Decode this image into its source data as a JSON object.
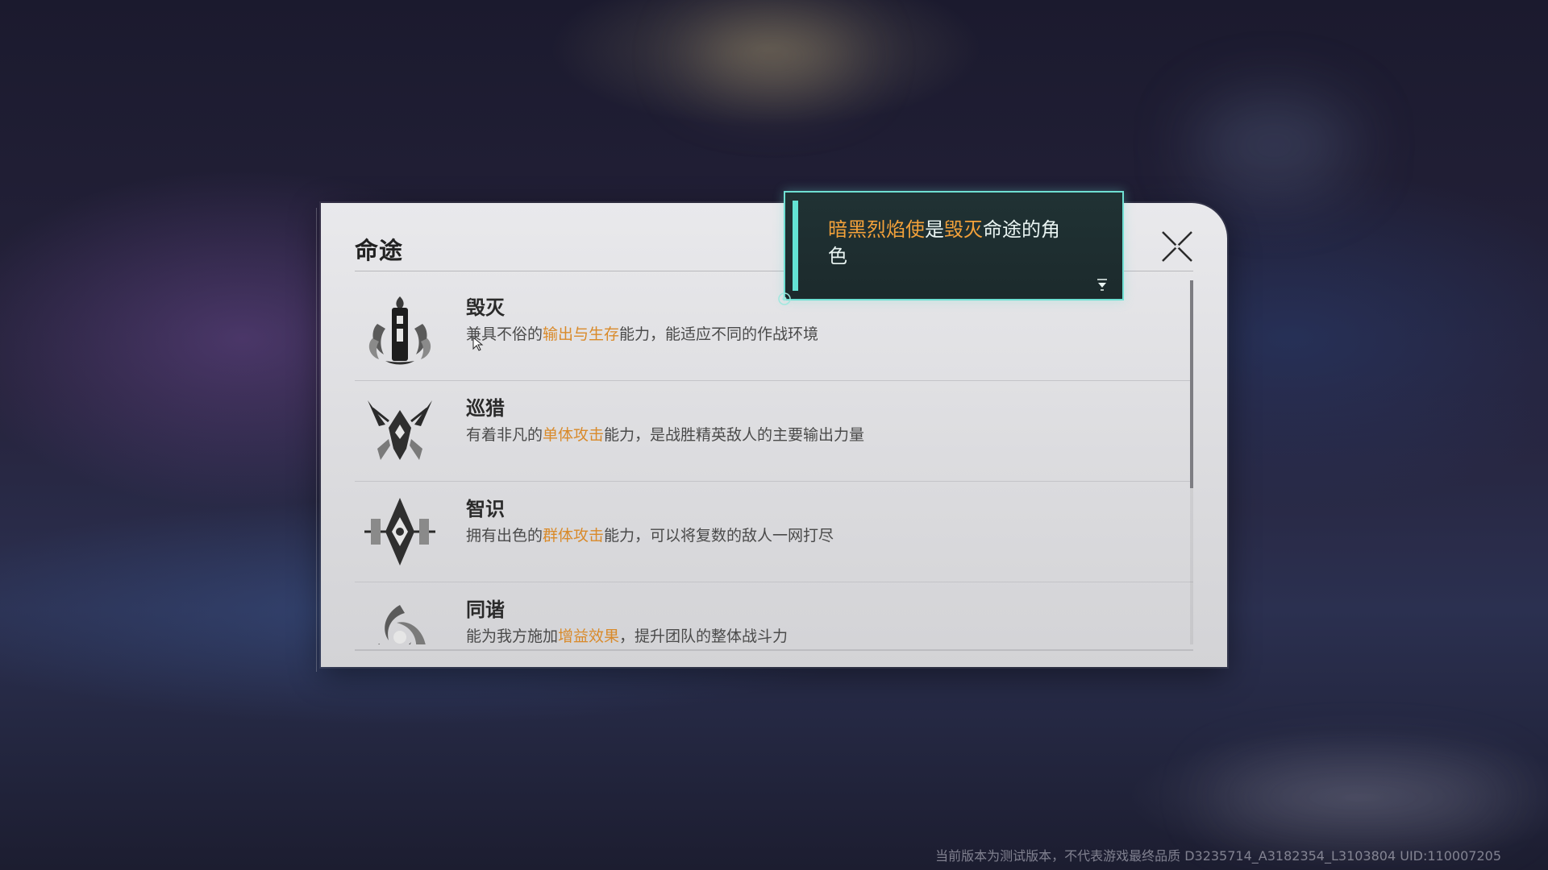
{
  "panel": {
    "title": "命途",
    "close_icon": "close-icon"
  },
  "paths": [
    {
      "name": "毁灭",
      "icon": "destruction-emblem-icon",
      "desc_pre": "兼具不俗的",
      "desc_highlight": "输出与生存",
      "desc_post": "能力，能适应不同的作战环境"
    },
    {
      "name": "巡猎",
      "icon": "hunt-emblem-icon",
      "desc_pre": "有着非凡的",
      "desc_highlight": "单体攻击",
      "desc_post": "能力，是战胜精英敌人的主要输出力量"
    },
    {
      "name": "智识",
      "icon": "erudition-emblem-icon",
      "desc_pre": "拥有出色的",
      "desc_highlight": "群体攻击",
      "desc_post": "能力，可以将复数的敌人一网打尽"
    },
    {
      "name": "同谐",
      "icon": "harmony-emblem-icon",
      "desc_pre": "能为我方施加",
      "desc_highlight": "增益效果",
      "desc_post": "，提升团队的整体战斗力"
    }
  ],
  "tooltip": {
    "character": "暗黑烈焰使",
    "mid": "是",
    "path": "毁灭",
    "suffix": "命途的角色"
  },
  "colors": {
    "highlight": "#d98a2a",
    "tooltip_border": "#6fe0d3",
    "tooltip_orange": "#f3a13a"
  },
  "footer": {
    "watermark": "当前版本为测试版本，不代表游戏最终品质 D3235714_A3182354_L3103804  UID:110007205"
  }
}
